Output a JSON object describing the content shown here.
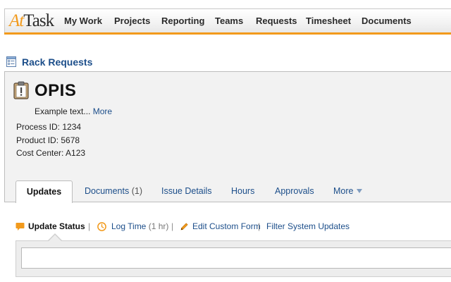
{
  "app": {
    "logo_part1": "At",
    "logo_part2": "Task"
  },
  "nav": {
    "items": [
      {
        "label": "My Work"
      },
      {
        "label": "Projects"
      },
      {
        "label": "Reporting"
      },
      {
        "label": "Teams"
      },
      {
        "label": "Requests"
      },
      {
        "label": "Timesheet"
      },
      {
        "label": "Documents"
      }
    ]
  },
  "section": {
    "title": "Rack Requests",
    "icon": "form-list-icon"
  },
  "issue": {
    "icon": "clipboard-alert-icon",
    "title": "OPIS",
    "description": "Example text...",
    "more_link": "More",
    "fields": [
      "Process ID: 1234",
      "Product ID: 5678",
      "Cost Center: A123"
    ]
  },
  "tabs": {
    "updates": "Updates",
    "documents": "Documents",
    "documents_count": "(1)",
    "issue_details": "Issue Details",
    "hours": "Hours",
    "approvals": "Approvals",
    "more": "More"
  },
  "toolbar": {
    "update_status": "Update Status",
    "log_time": "Log Time",
    "log_time_hint": "(1 hr)",
    "edit_custom_form": "Edit Custom Form",
    "filter_system_updates": "Filter System Updates",
    "separator": "|"
  },
  "update_input": {
    "value": "",
    "placeholder": ""
  },
  "colors": {
    "accent": "#f29a1c",
    "link": "#1c4e8a",
    "panel": "#f2f2f2"
  }
}
